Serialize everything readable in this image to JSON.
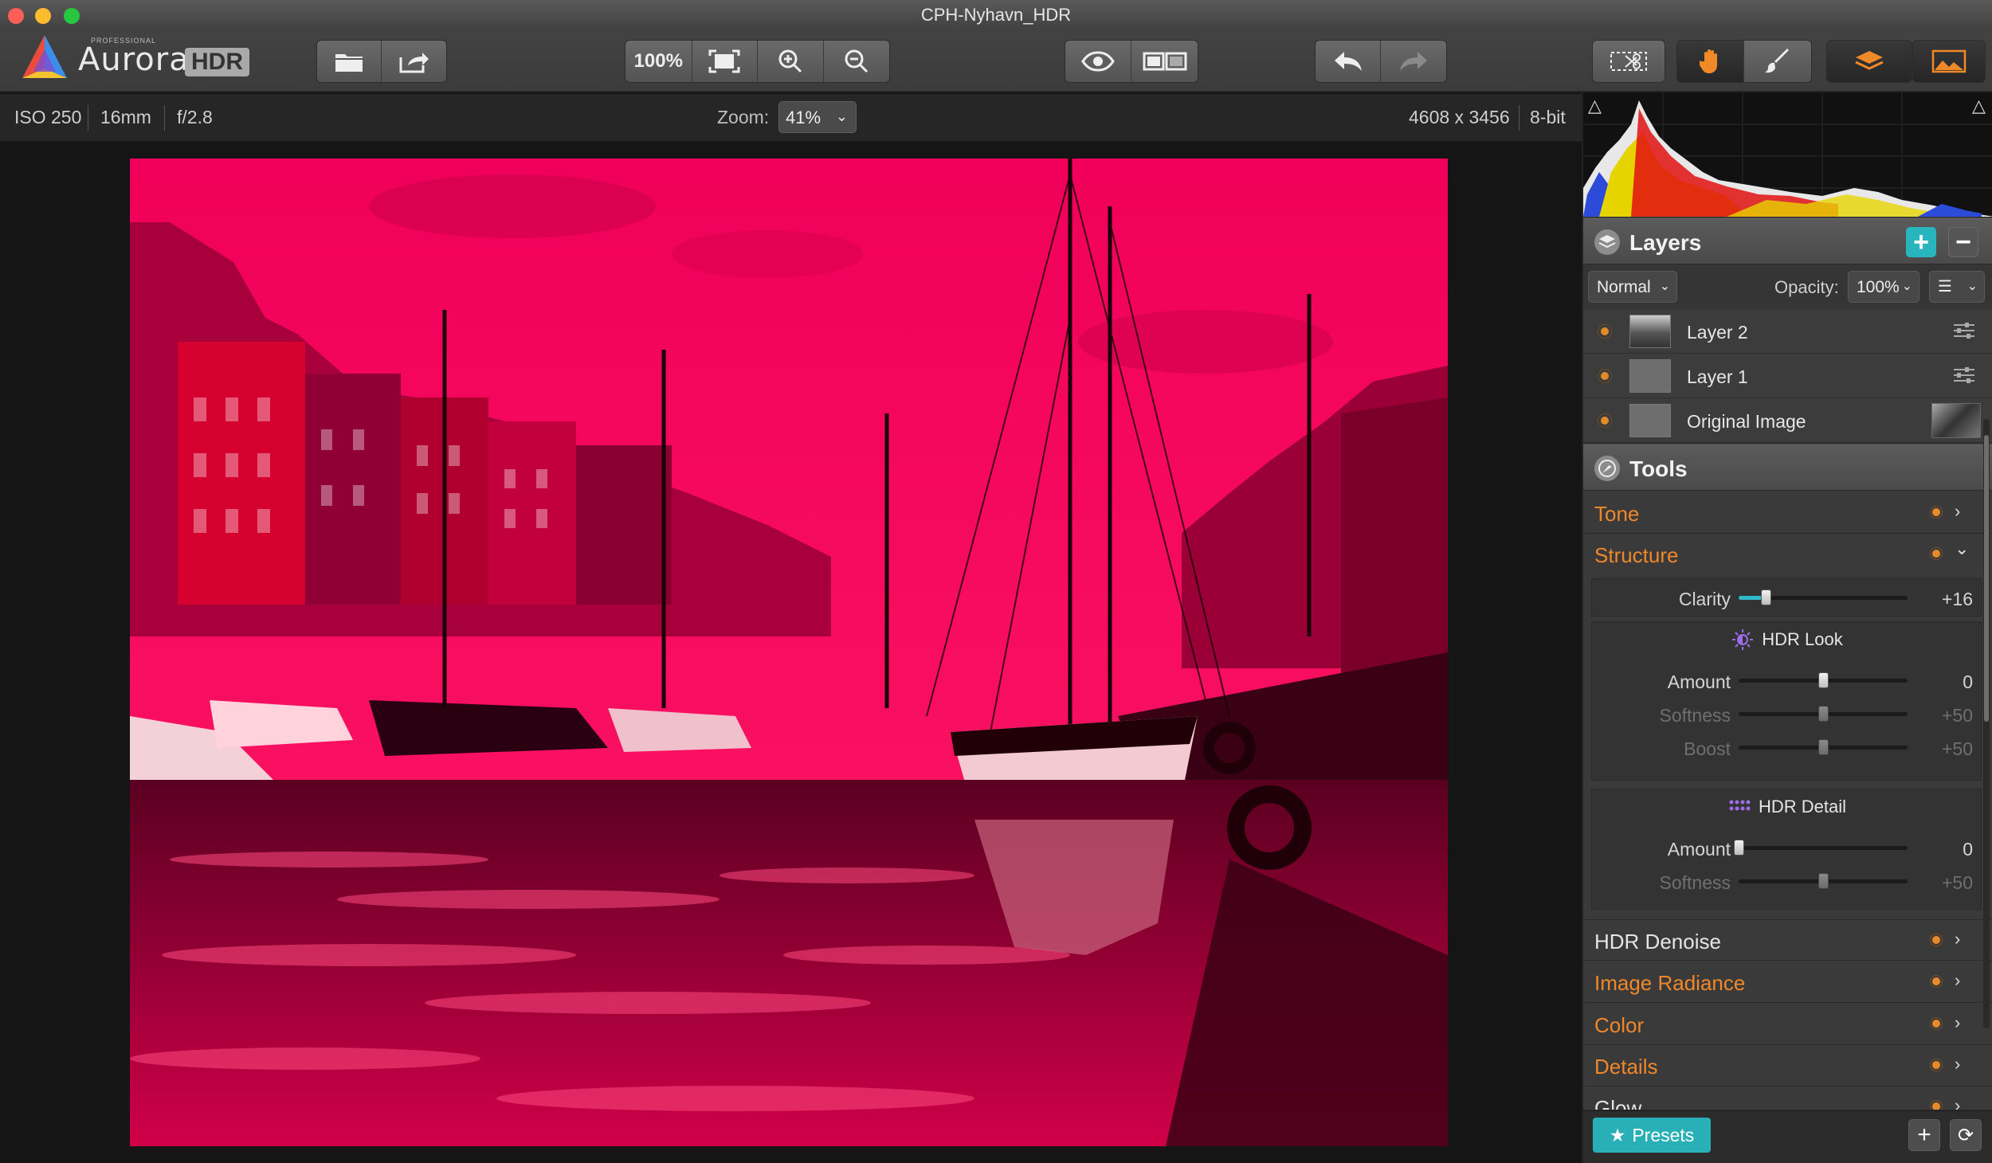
{
  "window": {
    "title": "CPH-Nyhavn_HDR"
  },
  "logo": {
    "brand": "Aurora",
    "badge": "HDR",
    "tag": "PROFESSIONAL"
  },
  "toolbar": {
    "zoom_100_label": "100%"
  },
  "info": {
    "iso": "ISO 250",
    "focal": "16mm",
    "aperture": "f/2.8",
    "zoom_label": "Zoom:",
    "zoom_value": "41%",
    "dimensions": "4608 x 3456",
    "bitdepth": "8-bit"
  },
  "layers": {
    "title": "Layers",
    "blend_mode": "Normal",
    "opacity_label": "Opacity:",
    "opacity_value": "100%",
    "items": [
      {
        "name": "Layer 2"
      },
      {
        "name": "Layer 1"
      },
      {
        "name": "Original Image"
      }
    ]
  },
  "tools": {
    "title": "Tools",
    "tone": "Tone",
    "structure": "Structure",
    "clarity": {
      "label": "Clarity",
      "value": "+16",
      "level": 0.16
    },
    "hdr_look": {
      "title": "HDR Look",
      "amount": {
        "label": "Amount",
        "value": "0",
        "level": 0.5
      },
      "softness": {
        "label": "Softness",
        "value": "+50",
        "level": 0.5
      },
      "boost": {
        "label": "Boost",
        "value": "+50",
        "level": 0.5
      }
    },
    "hdr_detail": {
      "title": "HDR Detail",
      "amount": {
        "label": "Amount",
        "value": "0",
        "level": 0.0
      },
      "softness": {
        "label": "Softness",
        "value": "+50",
        "level": 0.5
      }
    },
    "hdr_denoise": "HDR Denoise",
    "image_radiance": "Image Radiance",
    "color": "Color",
    "details": "Details",
    "glow": "Glow"
  },
  "bottom": {
    "presets": "Presets"
  },
  "colors": {
    "accent": "#30b9c8",
    "orange": "#f0882b",
    "photo_tint": "#e8004f"
  }
}
